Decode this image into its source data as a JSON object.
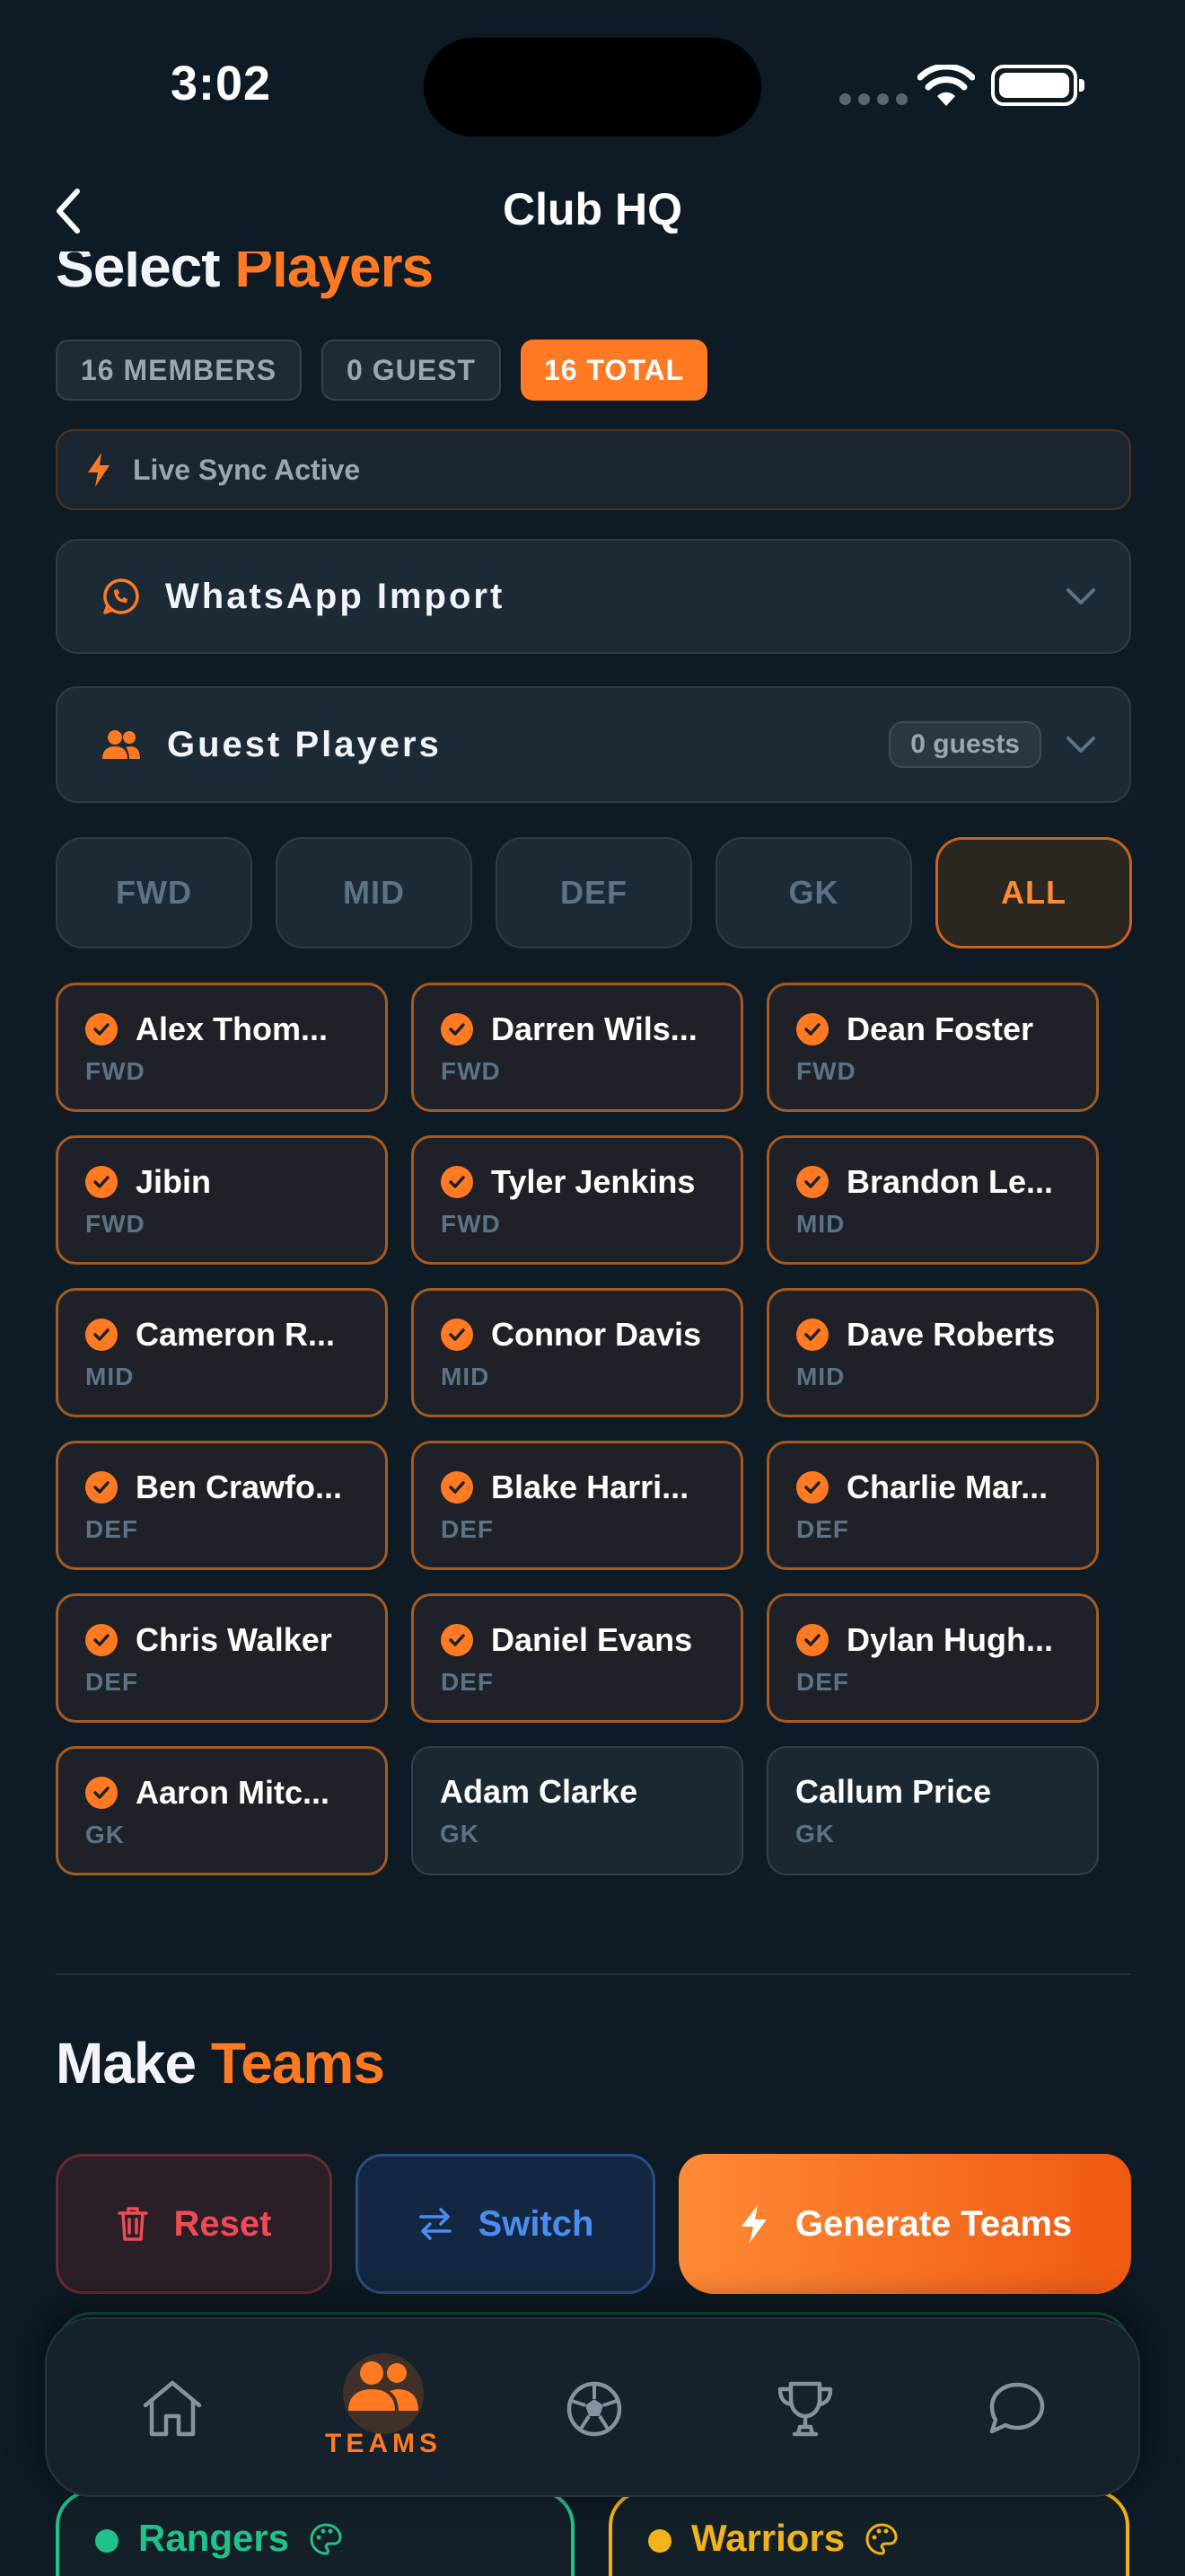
{
  "status_bar": {
    "time": "3:02"
  },
  "header": {
    "title": "Club HQ"
  },
  "select_section": {
    "title_main": "Select",
    "title_accent": "Players"
  },
  "badges": {
    "members": "16 MEMBERS",
    "guests": "0 GUEST",
    "total": "16 TOTAL"
  },
  "sync": {
    "label": "Live Sync Active"
  },
  "whatsapp": {
    "label": "WhatsApp Import"
  },
  "guest_players": {
    "label": "Guest Players",
    "count": "0 guests"
  },
  "filters": [
    "FWD",
    "MID",
    "DEF",
    "GK",
    "ALL"
  ],
  "active_filter": "ALL",
  "players": [
    {
      "name": "Alex Thom...",
      "pos": "FWD",
      "selected": true
    },
    {
      "name": "Darren Wils...",
      "pos": "FWD",
      "selected": true
    },
    {
      "name": "Dean Foster",
      "pos": "FWD",
      "selected": true
    },
    {
      "name": "Jibin",
      "pos": "FWD",
      "selected": true
    },
    {
      "name": "Tyler Jenkins",
      "pos": "FWD",
      "selected": true
    },
    {
      "name": "Brandon Le...",
      "pos": "MID",
      "selected": true
    },
    {
      "name": "Cameron R...",
      "pos": "MID",
      "selected": true
    },
    {
      "name": "Connor Davis",
      "pos": "MID",
      "selected": true
    },
    {
      "name": "Dave Roberts",
      "pos": "MID",
      "selected": true
    },
    {
      "name": "Ben Crawfo...",
      "pos": "DEF",
      "selected": true
    },
    {
      "name": "Blake Harri...",
      "pos": "DEF",
      "selected": true
    },
    {
      "name": "Charlie Mar...",
      "pos": "DEF",
      "selected": true
    },
    {
      "name": "Chris Walker",
      "pos": "DEF",
      "selected": true
    },
    {
      "name": "Daniel Evans",
      "pos": "DEF",
      "selected": true
    },
    {
      "name": "Dylan Hugh...",
      "pos": "DEF",
      "selected": true
    },
    {
      "name": "Aaron Mitc...",
      "pos": "GK",
      "selected": true
    },
    {
      "name": "Adam Clarke",
      "pos": "GK",
      "selected": false
    },
    {
      "name": "Callum Price",
      "pos": "GK",
      "selected": false
    }
  ],
  "make_section": {
    "title_main": "Make",
    "title_accent": "Teams"
  },
  "actions": {
    "reset": "Reset",
    "switch": "Switch",
    "generate": "Generate Teams"
  },
  "teams": [
    {
      "name": "Rangers",
      "color": "#22c08a"
    },
    {
      "name": "Warriors",
      "color": "#f2b21a"
    }
  ],
  "tabbar": {
    "active_label": "TEAMS"
  },
  "colors": {
    "accent": "#ff7a22",
    "background": "#0e1a24",
    "reset": "#ef4b55",
    "switch": "#4a8cf0"
  }
}
